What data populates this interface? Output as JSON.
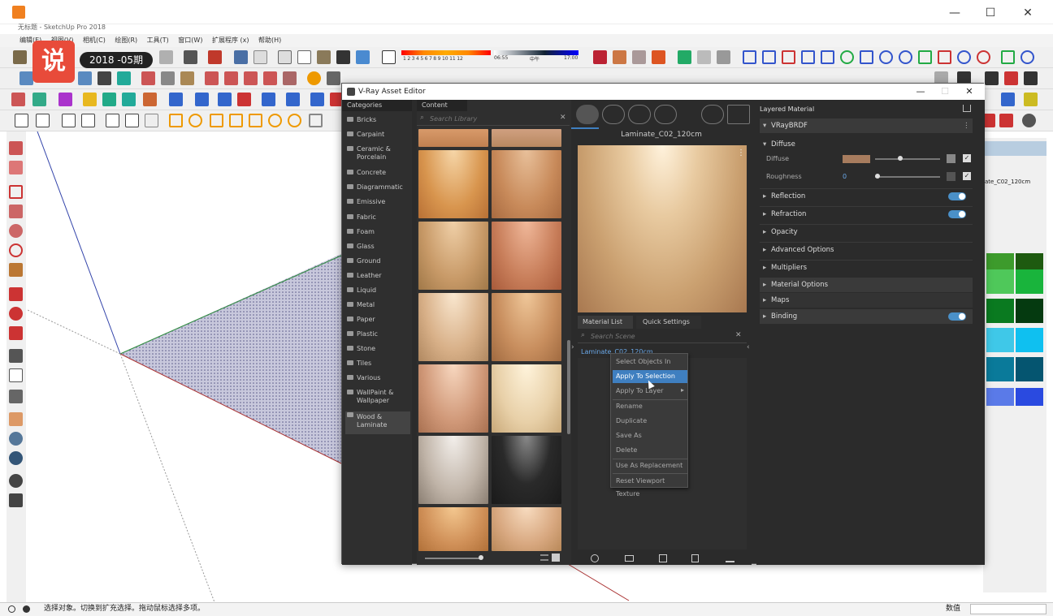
{
  "app": {
    "title": "无标题 - SketchUp Pro 2018",
    "window_buttons": {
      "minimize": "—",
      "maximize": "☐",
      "close": "✕"
    }
  },
  "menubar": [
    "编辑(E)",
    "视图(V)",
    "相机(C)",
    "绘图(R)",
    "工具(T)",
    "窗口(W)",
    "扩展程序 (x)",
    "帮助(H)"
  ],
  "logo": {
    "mark": "说",
    "badge": "2018 -05期"
  },
  "toolbar": {
    "shadow_ticks": [
      "1",
      "2",
      "3",
      "4",
      "5",
      "6",
      "7",
      "8",
      "9",
      "10",
      "11",
      "12"
    ],
    "time_start": "06:55",
    "time_mid": "中午",
    "time_end": "17:00"
  },
  "vray": {
    "window_title": "V-Ray Asset Editor",
    "categories_header": "Categories",
    "categories": [
      "Bricks",
      "Carpaint",
      "Ceramic & Porcelain",
      "Concrete",
      "Diagrammatic",
      "Emissive",
      "Fabric",
      "Foam",
      "Glass",
      "Ground",
      "Leather",
      "Liquid",
      "Metal",
      "Paper",
      "Plastic",
      "Stone",
      "Tiles",
      "Various",
      "WallPaint & Wallpaper",
      "Wood & Laminate"
    ],
    "selected_category": "Wood & Laminate",
    "content_header": "Content",
    "search_library_placeholder": "Search Library",
    "preview_title": "Laminate_C02_120cm",
    "material_list_tab": "Material List",
    "quick_settings_tab": "Quick Settings",
    "search_scene_placeholder": "Search Scene",
    "material_item": "Laminate_C02_120cm",
    "context_menu": [
      "Select Objects In Scene",
      "Apply To Selection",
      "Apply To Layer",
      "Rename",
      "Duplicate",
      "Save As",
      "Delete",
      "Use As Replacement",
      "Reset Viewport Texture"
    ],
    "highlighted_menu_item": "Apply To Selection",
    "props": {
      "header": "Layered Material",
      "brdf": "VRayBRDF",
      "diffuse_section": "Diffuse",
      "diffuse_label": "Diffuse",
      "roughness_label": "Roughness",
      "roughness_value": "0",
      "sections": [
        "Reflection",
        "Refraction",
        "Opacity",
        "Advanced Options",
        "Multipliers",
        "Material Options",
        "Maps",
        "Binding"
      ]
    },
    "colors": {
      "diffuse_swatch": "#a77c5e",
      "accent": "#3f7fc0"
    }
  },
  "right_panel": {
    "material_name": "ate_C02_120cm"
  },
  "status": {
    "hint": "选择对象。切换到扩充选择。拖动鼠标选择多项。",
    "measure_label": "数值"
  }
}
